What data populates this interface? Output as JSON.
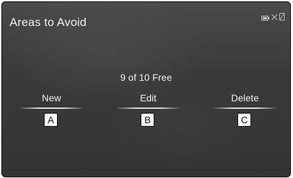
{
  "header": {
    "title": "Areas to Avoid",
    "status_icons": [
      "battery-icon",
      "signal-off-icon",
      "phone-icon"
    ]
  },
  "main": {
    "free_count": "9 of 10 Free",
    "actions": [
      {
        "label": "New",
        "callout": "A"
      },
      {
        "label": "Edit",
        "callout": "B"
      },
      {
        "label": "Delete",
        "callout": "C"
      }
    ]
  },
  "colors": {
    "text": "#f2f2f2",
    "background": "#3c3c3c"
  }
}
